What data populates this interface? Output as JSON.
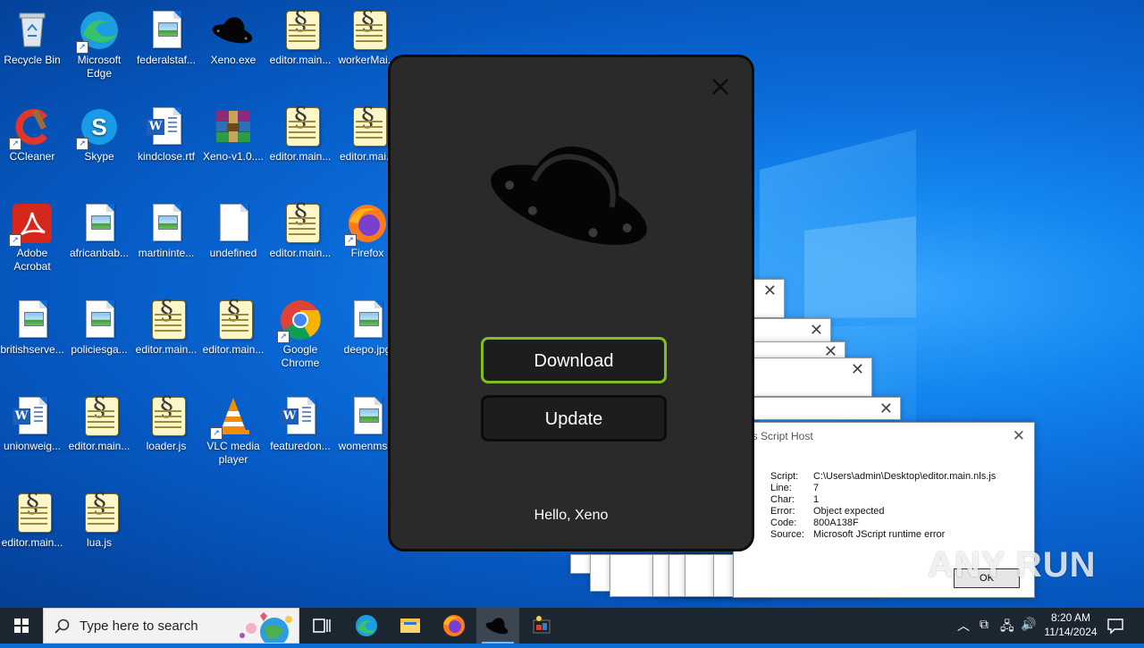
{
  "desktop": {
    "icons": [
      {
        "label": "Recycle Bin",
        "kind": "recycle-bin"
      },
      {
        "label": "Microsoft Edge",
        "kind": "edge"
      },
      {
        "label": "federalstaf...",
        "kind": "image"
      },
      {
        "label": "Xeno.exe",
        "kind": "xeno"
      },
      {
        "label": "editor.main...",
        "kind": "script"
      },
      {
        "label": "workerMai...",
        "kind": "script"
      },
      {
        "label": "CCleaner",
        "kind": "ccleaner"
      },
      {
        "label": "Skype",
        "kind": "skype"
      },
      {
        "label": "kindclose.rtf",
        "kind": "word"
      },
      {
        "label": "Xeno-v1.0....",
        "kind": "winrar"
      },
      {
        "label": "editor.main...",
        "kind": "script"
      },
      {
        "label": "editor.mai...",
        "kind": "script"
      },
      {
        "label": "Adobe Acrobat",
        "kind": "acrobat"
      },
      {
        "label": "africanbab...",
        "kind": "image"
      },
      {
        "label": "martininte...",
        "kind": "image"
      },
      {
        "label": "undefined",
        "kind": "blank"
      },
      {
        "label": "editor.main...",
        "kind": "script"
      },
      {
        "label": "Firefox",
        "kind": "firefox"
      },
      {
        "label": "britishserve...",
        "kind": "image"
      },
      {
        "label": "policiesga...",
        "kind": "image"
      },
      {
        "label": "editor.main...",
        "kind": "script"
      },
      {
        "label": "editor.main...",
        "kind": "script"
      },
      {
        "label": "Google Chrome",
        "kind": "chrome"
      },
      {
        "label": "deepo.jpg",
        "kind": "image"
      },
      {
        "label": "unionweig...",
        "kind": "word"
      },
      {
        "label": "editor.main...",
        "kind": "script"
      },
      {
        "label": "loader.js",
        "kind": "script"
      },
      {
        "label": "VLC media player",
        "kind": "vlc"
      },
      {
        "label": "featuredon...",
        "kind": "word"
      },
      {
        "label": "womenms...",
        "kind": "image"
      },
      {
        "label": "editor.main...",
        "kind": "script"
      },
      {
        "label": "lua.js",
        "kind": "script"
      }
    ]
  },
  "wsh_dialog": {
    "title": "ws Script Host",
    "rows": [
      {
        "key": "Script:",
        "value": "C:\\Users\\admin\\Desktop\\editor.main.nls.js"
      },
      {
        "key": "Line:",
        "value": "7"
      },
      {
        "key": "Char:",
        "value": "1"
      },
      {
        "key": "Error:",
        "value": "Object expected"
      },
      {
        "key": "Code:",
        "value": "800A138F"
      },
      {
        "key": "Source:",
        "value": "Microsoft JScript runtime error"
      }
    ],
    "ok_label": "OK"
  },
  "watermark": "ANY RUN",
  "xeno_window": {
    "download_label": "Download",
    "update_label": "Update",
    "greeting": "Hello, Xeno",
    "download_border_color": "#7fbf1f"
  },
  "taskbar": {
    "search_placeholder": "Type here to search",
    "time": "8:20 AM",
    "date": "11/14/2024"
  }
}
